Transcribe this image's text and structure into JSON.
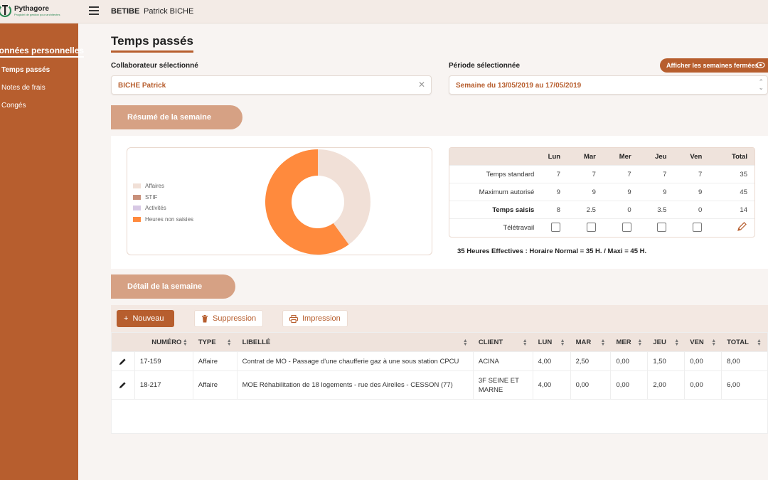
{
  "app": {
    "name": "Pythagore",
    "tagline": "Progiciel de gestion pour architectes"
  },
  "header": {
    "company": "BETIBE",
    "user": "Patrick BICHE"
  },
  "sidebar": {
    "section": "Données personnelles",
    "items": [
      {
        "label": "Temps passés",
        "active": true
      },
      {
        "label": "Notes de frais",
        "active": false
      },
      {
        "label": "Congés",
        "active": false
      }
    ]
  },
  "page": {
    "title": "Temps passés"
  },
  "filters": {
    "collaborator_label": "Collaborateur sélectionné",
    "collaborator_value": "BICHE Patrick",
    "period_label": "Période sélectionnée",
    "period_value": "Semaine du 13/05/2019 au 17/05/2019",
    "closed_weeks_button": "Afficher les semaines fermées"
  },
  "summary": {
    "tab_label": "Résumé de la semaine",
    "legend": [
      {
        "label": "Affaires",
        "color": "#f1e0d7"
      },
      {
        "label": "STIF",
        "color": "#c8907a"
      },
      {
        "label": "Activités",
        "color": "#d7c8e4"
      },
      {
        "label": "Heures non saisies",
        "color": "#ff8a3d"
      }
    ],
    "chart_data": {
      "type": "pie",
      "slices": [
        {
          "label": "Affaires",
          "value": 14
        },
        {
          "label": "STIF",
          "value": 0
        },
        {
          "label": "Activités",
          "value": 0
        },
        {
          "label": "Heures non saisies",
          "value": 21
        }
      ]
    },
    "table": {
      "headers": [
        "Lun",
        "Mar",
        "Mer",
        "Jeu",
        "Ven",
        "Total"
      ],
      "rows": [
        {
          "label": "Temps standard",
          "values": [
            "7",
            "7",
            "7",
            "7",
            "7",
            "35"
          ],
          "bold": false
        },
        {
          "label": "Maximum autorisé",
          "values": [
            "9",
            "9",
            "9",
            "9",
            "9",
            "45"
          ],
          "bold": false
        },
        {
          "label": "Temps saisis",
          "values": [
            "8",
            "2.5",
            "0",
            "3.5",
            "0",
            "14"
          ],
          "bold": true
        }
      ],
      "telework_label": "Télétravail",
      "telework": [
        false,
        false,
        false,
        false,
        false
      ]
    },
    "note": "35 Heures Effectives : Horaire Normal = 35 H. / Maxi = 45 H."
  },
  "detail": {
    "tab_label": "Détail de la semaine",
    "buttons": {
      "new": "Nouveau",
      "delete": "Suppression",
      "print": "Impression"
    },
    "columns": [
      "NUMÉRO",
      "TYPE",
      "LIBELLÉ",
      "CLIENT",
      "LUN",
      "MAR",
      "MER",
      "JEU",
      "VEN",
      "TOTAL"
    ],
    "rows": [
      {
        "numero": "17-159",
        "type": "Affaire",
        "libelle": "Contrat de MO - Passage d'une chaufferie gaz à une sous station CPCU",
        "client": "ACINA",
        "lun": "4,00",
        "mar": "2,50",
        "mer": "0,00",
        "jeu": "1,50",
        "ven": "0,00",
        "total": "8,00"
      },
      {
        "numero": "18-217",
        "type": "Affaire",
        "libelle": "MOE Réhabilitation de 18 logements - rue des Airelles - CESSON (77)",
        "client": "3F SEINE ET MARNE",
        "lun": "4,00",
        "mar": "0,00",
        "mer": "0,00",
        "jeu": "2,00",
        "ven": "0,00",
        "total": "6,00"
      }
    ]
  },
  "colors": {
    "accent": "#b75e2e",
    "tab": "#d6a184",
    "header_bg": "#f3ebe6"
  }
}
